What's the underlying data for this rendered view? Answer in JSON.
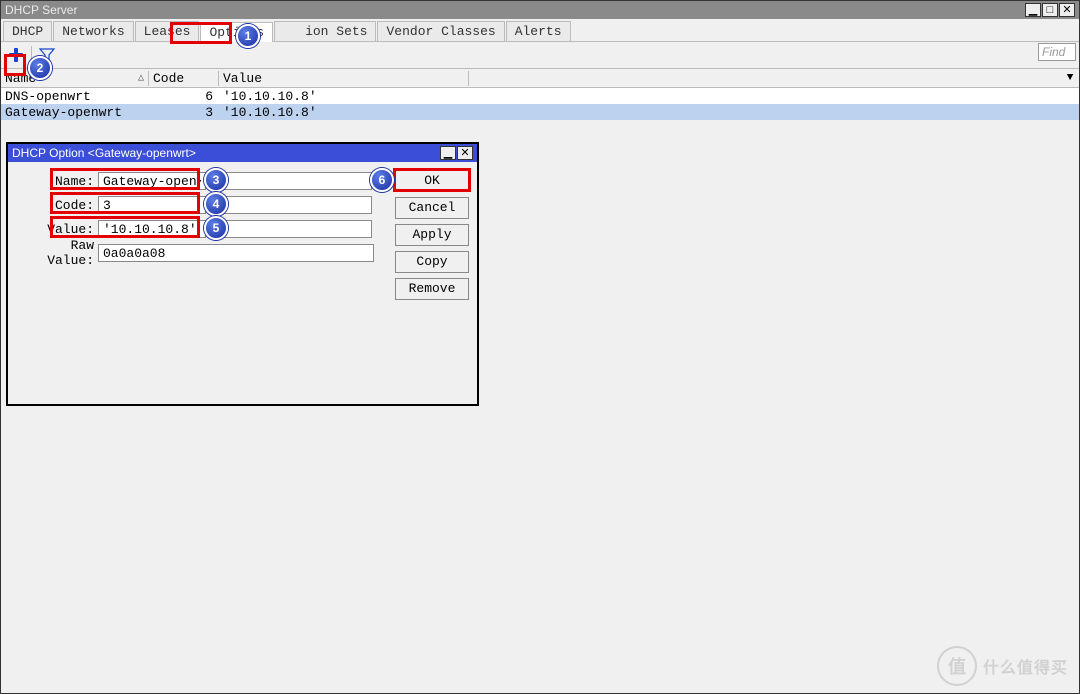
{
  "main_window": {
    "title": "DHCP Server",
    "tabs": [
      "DHCP",
      "Networks",
      "Leases",
      "Options",
      "(hidden)ion Sets",
      "Vendor Classes",
      "Alerts"
    ],
    "active_tab_index": 3,
    "find_placeholder": "Find",
    "columns": {
      "name": "Name",
      "code": "Code",
      "value": "Value"
    },
    "rows": [
      {
        "name": "DNS-openwrt",
        "code": "6",
        "value": "'10.10.10.8'",
        "selected": false
      },
      {
        "name": "Gateway-openwrt",
        "code": "3",
        "value": "'10.10.10.8'",
        "selected": true
      }
    ]
  },
  "dialog": {
    "title": "DHCP Option <Gateway-openwrt>",
    "fields": {
      "name_label": "Name:",
      "name_value": "Gateway-openwrt",
      "code_label": "Code:",
      "code_value": "3",
      "value_label": "Value:",
      "value_value": "'10.10.10.8'",
      "raw_label": "Raw Value:",
      "raw_value": "0a0a0a08"
    },
    "buttons": {
      "ok": "OK",
      "cancel": "Cancel",
      "apply": "Apply",
      "copy": "Copy",
      "remove": "Remove"
    }
  },
  "callouts": {
    "1": "1",
    "2": "2",
    "3": "3",
    "4": "4",
    "5": "5",
    "6": "6"
  },
  "watermark": {
    "badge": "值",
    "text": "什么值得买"
  }
}
